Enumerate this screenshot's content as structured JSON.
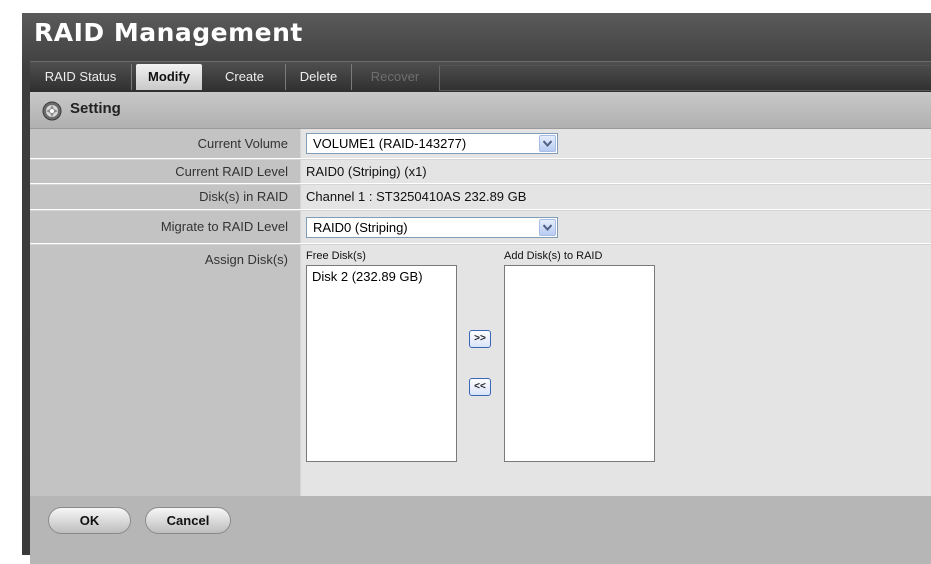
{
  "title": "RAID Management",
  "tabs": [
    {
      "label": "RAID Status",
      "state": "normal"
    },
    {
      "label": "Modify",
      "state": "active"
    },
    {
      "label": "Create",
      "state": "normal"
    },
    {
      "label": "Delete",
      "state": "normal"
    },
    {
      "label": "Recover",
      "state": "disabled"
    }
  ],
  "section": {
    "icon": "gear-icon",
    "title": "Setting"
  },
  "fields": {
    "current_volume": {
      "label": "Current Volume",
      "value": "VOLUME1 (RAID-143277)"
    },
    "current_raid_level": {
      "label": "Current RAID Level",
      "value": "RAID0 (Striping) (x1)"
    },
    "disks_in_raid": {
      "label": "Disk(s) in RAID",
      "value": "Channel 1 : ST3250410AS 232.89 GB"
    },
    "migrate_level": {
      "label": "Migrate to RAID Level",
      "value": "RAID0 (Striping)"
    },
    "assign_disks": {
      "label": "Assign Disk(s)",
      "free_caption": "Free Disk(s)",
      "free_items": [
        "Disk 2 (232.89 GB)"
      ],
      "add_caption": "Add Disk(s) to RAID",
      "add_items": [],
      "add_button": ">>",
      "remove_button": "<<"
    }
  },
  "buttons": {
    "ok": "OK",
    "cancel": "Cancel"
  },
  "colors": {
    "header_bg": "#3d3d3d",
    "label_bg": "#c3c3c3",
    "value_bg": "#e4e4e4",
    "select_border": "#7f9db9"
  }
}
